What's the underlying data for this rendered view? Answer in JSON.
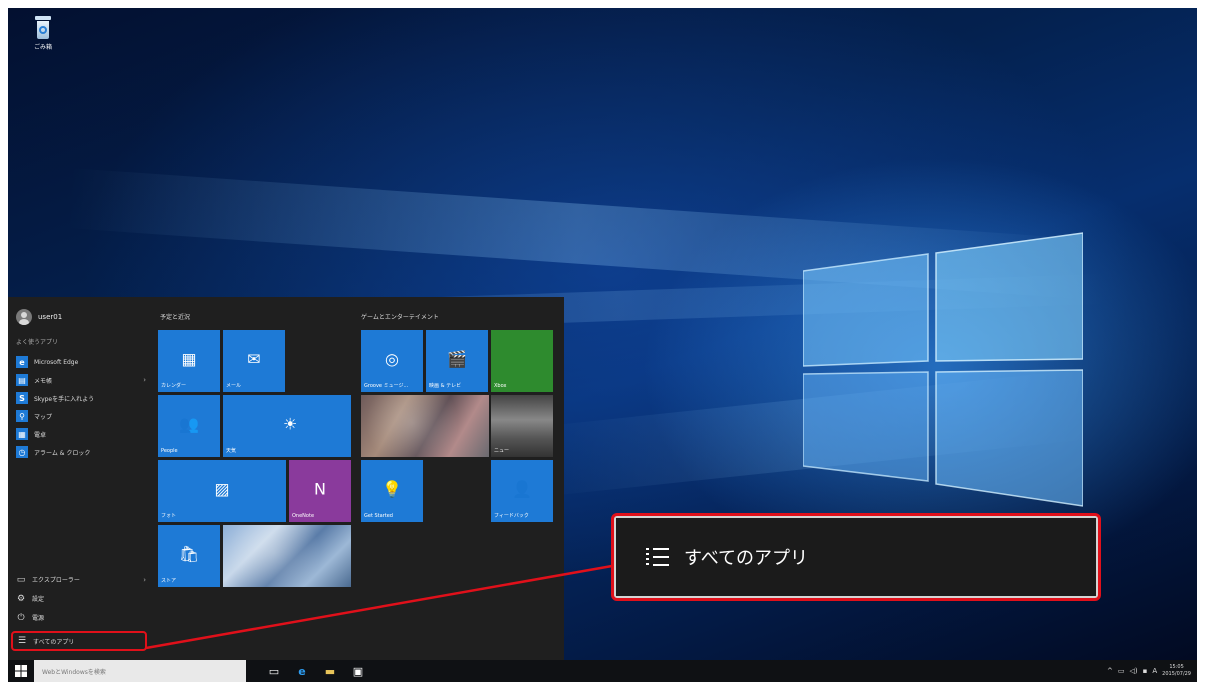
{
  "desktop": {
    "recycle_bin_label": "ごみ箱"
  },
  "start_menu": {
    "user_name": "user01",
    "most_used_label": "よく使うアプリ",
    "apps": [
      {
        "label": "Microsoft Edge",
        "icon": "edge-icon",
        "has_submenu": false
      },
      {
        "label": "メモ帳",
        "icon": "notepad-icon",
        "has_submenu": true
      },
      {
        "label": "Skypeを手に入れよう",
        "icon": "skype-icon",
        "has_submenu": false
      },
      {
        "label": "マップ",
        "icon": "maps-icon",
        "has_submenu": false
      },
      {
        "label": "電卓",
        "icon": "calculator-icon",
        "has_submenu": false
      },
      {
        "label": "アラーム & クロック",
        "icon": "alarm-icon",
        "has_submenu": false
      }
    ],
    "bottom": {
      "explorer": "エクスプローラー",
      "settings": "設定",
      "power": "電源",
      "all_apps": "すべてのアプリ"
    },
    "groups": {
      "left_title": "予定と近況",
      "right_title": "ゲームとエンターテイメント"
    },
    "tiles": {
      "calendar": "カレンダー",
      "mail": "メール",
      "people": "People",
      "weather": "天気",
      "photos": "フォト",
      "onenote": "OneNote",
      "store": "ストア",
      "groove": "Groove ミュージ...",
      "movies": "映画 & テレビ",
      "xbox": "Xbox",
      "news": "ニュー",
      "get_started": "Get Started",
      "feedback": "フィードバック"
    }
  },
  "callout": {
    "label": "すべてのアプリ",
    "accent": "#e0101a"
  },
  "taskbar": {
    "search_placeholder": "WebとWindowsを検索",
    "tray_lang": "A",
    "time": "15:05",
    "date": "2015/07/29"
  }
}
